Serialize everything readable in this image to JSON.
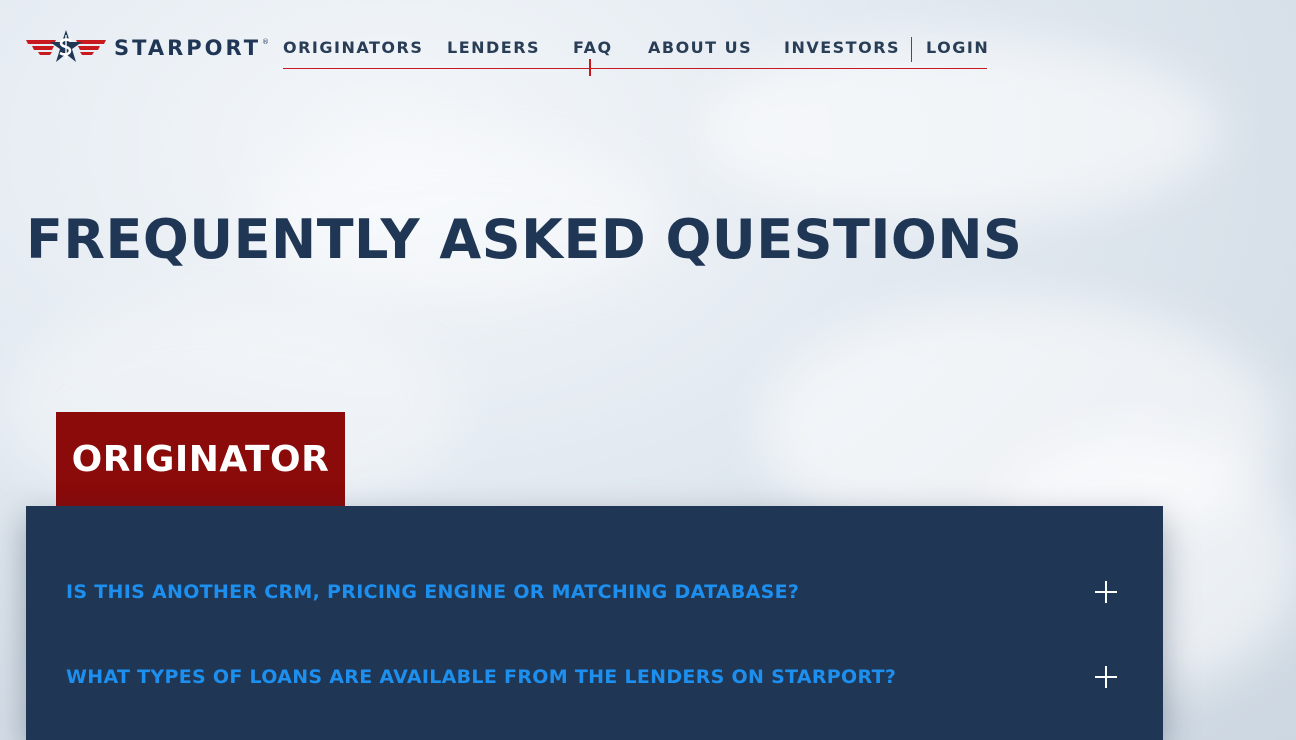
{
  "brand": {
    "name": "STARPORT",
    "registered_mark": "®",
    "colors": {
      "navy": "#1f3655",
      "red": "#c8191f",
      "dark_red": "#8b0a0a",
      "link_blue": "#1d8fef"
    }
  },
  "nav": {
    "items": [
      {
        "label": "ORIGINATORS"
      },
      {
        "label": "LENDERS"
      },
      {
        "label": "FAQ",
        "active": true
      },
      {
        "label": "ABOUT US"
      },
      {
        "label": "INVESTORS"
      },
      {
        "label": "LOGIN"
      }
    ]
  },
  "page": {
    "title": "FREQUENTLY ASKED QUESTIONS"
  },
  "section": {
    "label": "ORIGINATOR",
    "questions": [
      {
        "text": "IS THIS ANOTHER CRM, PRICING ENGINE OR MATCHING DATABASE?",
        "icon": "plus-icon"
      },
      {
        "text": "WHAT TYPES OF LOANS ARE AVAILABLE FROM THE LENDERS ON STARPORT?",
        "icon": "plus-icon"
      }
    ]
  }
}
